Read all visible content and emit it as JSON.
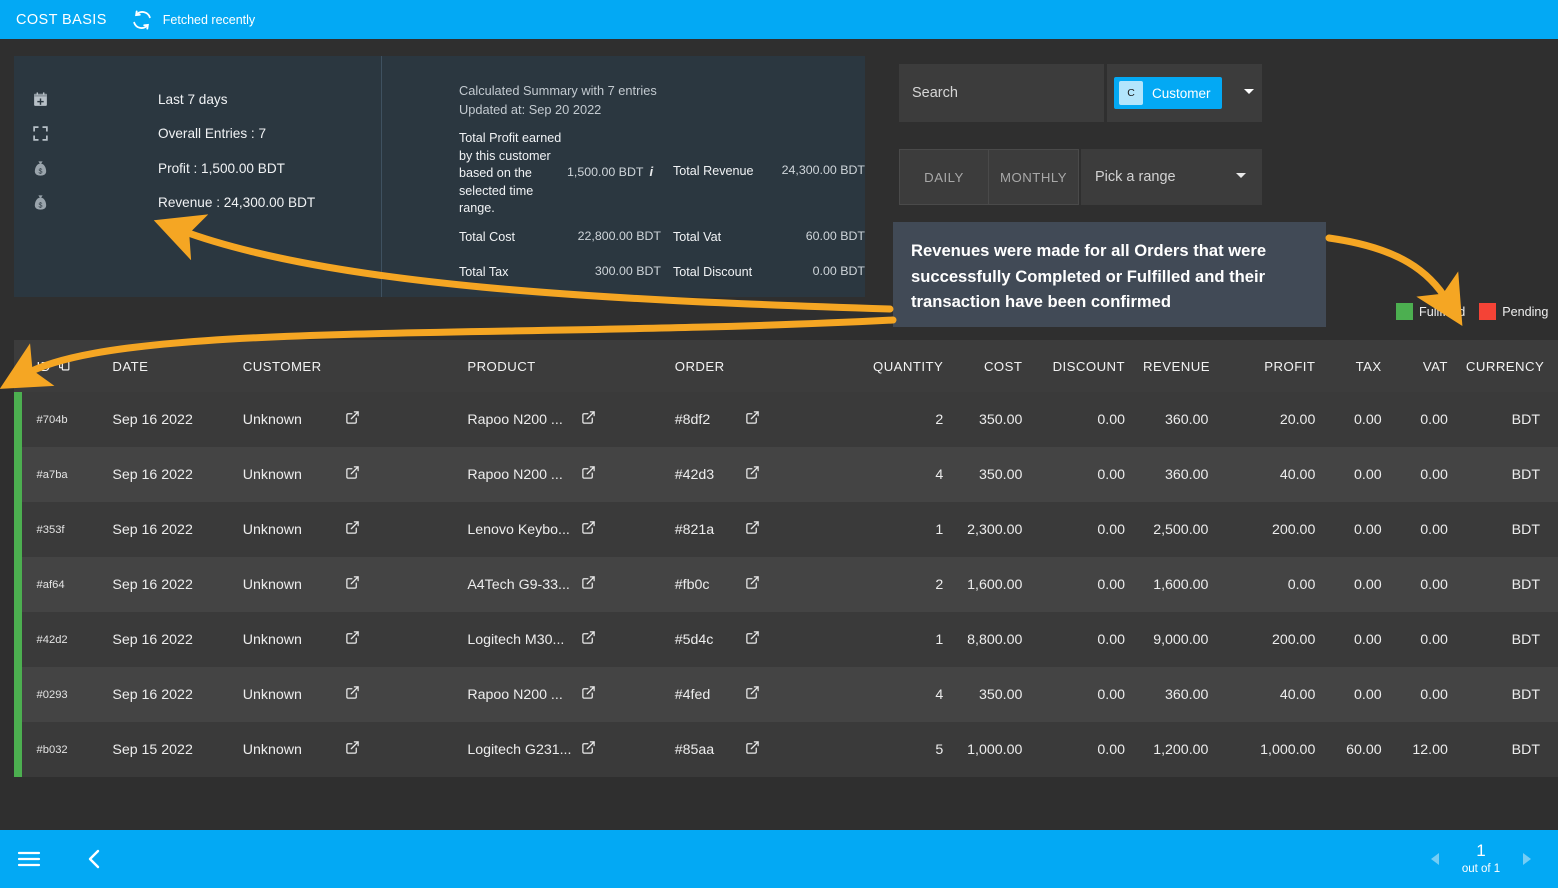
{
  "topbar": {
    "title": "COST BASIS",
    "refresh_icon": "refresh-icon",
    "status": "Fetched recently"
  },
  "summary": {
    "left": [
      {
        "icon": "calendar-plus-icon",
        "label": "Last 7 days"
      },
      {
        "icon": "expand-icon",
        "label": "Overall Entries : 7"
      },
      {
        "icon": "money-bag-icon",
        "label": "Profit : 1,500.00 BDT"
      },
      {
        "icon": "money-bag-icon",
        "label": "Revenue : 24,300.00 BDT"
      }
    ],
    "calc_title": "Calculated Summary with 7 entries",
    "calc_updated": "Updated at: Sep 20 2022",
    "stats": {
      "profit_name": "Total Profit earned by this customer based on the selected time range.",
      "profit_value": "1,500.00 BDT",
      "profit_info_icon": "info-icon",
      "revenue_name": "Total Revenue",
      "revenue_value": "24,300.00 BDT",
      "cost_name": "Total Cost",
      "cost_value": "22,800.00 BDT",
      "vat_name": "Total Vat",
      "vat_value": "60.00 BDT",
      "tax_name": "Total Tax",
      "tax_value": "300.00 BDT",
      "discount_name": "Total Discount",
      "discount_value": "0.00 BDT"
    }
  },
  "controls": {
    "search_placeholder": "Search",
    "search_value": "",
    "chip_initial": "C",
    "chip_label": "Customer",
    "chip_caret_icon": "chevron-down-icon",
    "daily_label": "DAILY",
    "monthly_label": "MONTHLY",
    "picker_label": "Pick a range",
    "picker_caret_icon": "chevron-down-icon"
  },
  "callout": {
    "text": "Revenues were made for all Orders that were successfully Completed or Fulfilled and their transaction have been confirmed",
    "bg": "#414a56"
  },
  "legend": [
    {
      "label": "Fullfilled",
      "color": "#4caf50"
    },
    {
      "label": "Pending",
      "color": "#f44336"
    }
  ],
  "table": {
    "columns": [
      {
        "key": "id",
        "label": "ID",
        "align": "left",
        "icon": "copy-icon"
      },
      {
        "key": "date",
        "label": "DATE",
        "align": "left"
      },
      {
        "key": "customer",
        "label": "CUSTOMER",
        "align": "left"
      },
      {
        "key": "product",
        "label": "PRODUCT",
        "align": "left"
      },
      {
        "key": "order",
        "label": "ORDER",
        "align": "left"
      },
      {
        "key": "quantity",
        "label": "QUANTITY",
        "align": "right"
      },
      {
        "key": "cost",
        "label": "COST",
        "align": "right"
      },
      {
        "key": "discount",
        "label": "DISCOUNT",
        "align": "right"
      },
      {
        "key": "revenue",
        "label": "REVENUE",
        "align": "right"
      },
      {
        "key": "profit",
        "label": "PROFIT",
        "align": "right"
      },
      {
        "key": "tax",
        "label": "TAX",
        "align": "right"
      },
      {
        "key": "vat",
        "label": "VAT",
        "align": "right"
      },
      {
        "key": "currency",
        "label": "CURRENCY",
        "align": "right"
      }
    ],
    "rows": [
      {
        "status": "#4caf50",
        "id": "#704b",
        "date": "Sep 16 2022",
        "customer": "Unknown",
        "product": "Rapoo N200 ...",
        "order": "#8df2",
        "quantity": "2",
        "cost": "350.00",
        "discount": "0.00",
        "revenue": "360.00",
        "profit": "20.00",
        "tax": "0.00",
        "vat": "0.00",
        "currency": "BDT"
      },
      {
        "status": "#4caf50",
        "id": "#a7ba",
        "date": "Sep 16 2022",
        "customer": "Unknown",
        "product": "Rapoo N200 ...",
        "order": "#42d3",
        "quantity": "4",
        "cost": "350.00",
        "discount": "0.00",
        "revenue": "360.00",
        "profit": "40.00",
        "tax": "0.00",
        "vat": "0.00",
        "currency": "BDT"
      },
      {
        "status": "#4caf50",
        "id": "#353f",
        "date": "Sep 16 2022",
        "customer": "Unknown",
        "product": "Lenovo Keybo...",
        "order": "#821a",
        "quantity": "1",
        "cost": "2,300.00",
        "discount": "0.00",
        "revenue": "2,500.00",
        "profit": "200.00",
        "tax": "0.00",
        "vat": "0.00",
        "currency": "BDT"
      },
      {
        "status": "#4caf50",
        "id": "#af64",
        "date": "Sep 16 2022",
        "customer": "Unknown",
        "product": "A4Tech G9-33...",
        "order": "#fb0c",
        "quantity": "2",
        "cost": "1,600.00",
        "discount": "0.00",
        "revenue": "1,600.00",
        "profit": "0.00",
        "tax": "0.00",
        "vat": "0.00",
        "currency": "BDT"
      },
      {
        "status": "#4caf50",
        "id": "#42d2",
        "date": "Sep 16 2022",
        "customer": "Unknown",
        "product": "Logitech M30...",
        "order": "#5d4c",
        "quantity": "1",
        "cost": "8,800.00",
        "discount": "0.00",
        "revenue": "9,000.00",
        "profit": "200.00",
        "tax": "0.00",
        "vat": "0.00",
        "currency": "BDT"
      },
      {
        "status": "#4caf50",
        "id": "#0293",
        "date": "Sep 16 2022",
        "customer": "Unknown",
        "product": "Rapoo N200 ...",
        "order": "#4fed",
        "quantity": "4",
        "cost": "350.00",
        "discount": "0.00",
        "revenue": "360.00",
        "profit": "40.00",
        "tax": "0.00",
        "vat": "0.00",
        "currency": "BDT"
      },
      {
        "status": "#4caf50",
        "id": "#b032",
        "date": "Sep 15 2022",
        "customer": "Unknown",
        "product": "Logitech G231...",
        "order": "#85aa",
        "quantity": "5",
        "cost": "1,000.00",
        "discount": "0.00",
        "revenue": "1,200.00",
        "profit": "1,000.00",
        "tax": "60.00",
        "vat": "12.00",
        "currency": "BDT"
      }
    ]
  },
  "footer": {
    "menu_icon": "hamburger-icon",
    "back_icon": "chevron-left-icon",
    "prev_icon": "triangle-left-icon",
    "next_icon": "triangle-right-icon",
    "page_number": "1",
    "page_of": "out of 1"
  },
  "colors": {
    "accent": "#03a9f4",
    "panel": "#2b3740",
    "page_bg": "#2f2f2f",
    "row_odd": "#3a3a3a",
    "row_even": "#444444",
    "annotation": "#f5a623"
  }
}
